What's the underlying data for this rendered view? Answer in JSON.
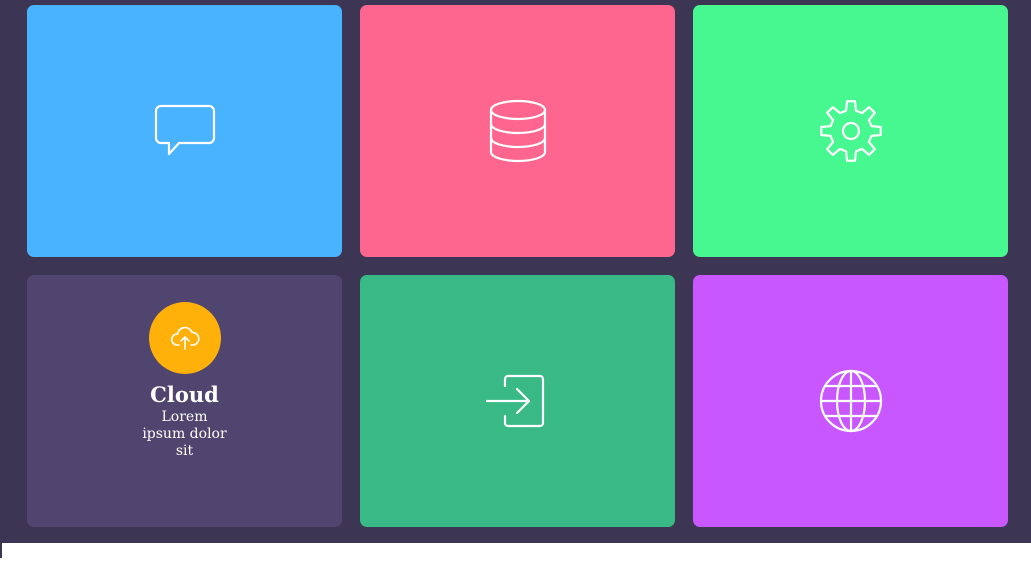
{
  "colors": {
    "background": "#3d3554",
    "tile_chat": "#4ab3ff",
    "tile_database": "#ff668f",
    "tile_settings": "#47f78f",
    "tile_cloud": "#4f456e",
    "tile_login": "#38b985",
    "tile_globe": "#c957ff",
    "cloud_circle": "#ffb10a"
  },
  "tiles": [
    {
      "id": "chat",
      "icon": "chat-bubble-icon"
    },
    {
      "id": "database",
      "icon": "database-icon"
    },
    {
      "id": "settings",
      "icon": "gear-icon"
    },
    {
      "id": "cloud",
      "icon": "cloud-upload-icon",
      "title": "Cloud",
      "description": "Lorem ipsum dolor sit"
    },
    {
      "id": "login",
      "icon": "login-icon"
    },
    {
      "id": "globe",
      "icon": "globe-icon"
    }
  ]
}
